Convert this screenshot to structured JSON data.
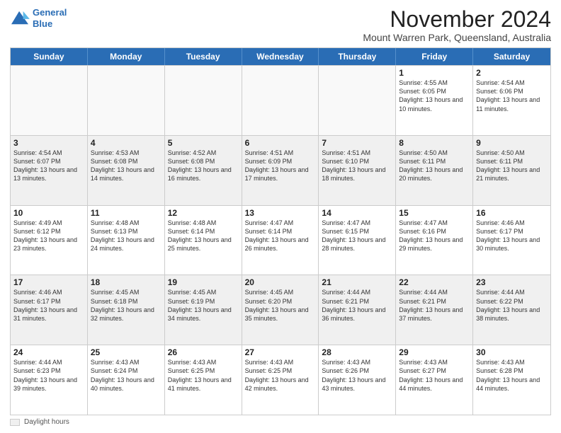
{
  "header": {
    "logo_line1": "General",
    "logo_line2": "Blue",
    "month_title": "November 2024",
    "location": "Mount Warren Park, Queensland, Australia"
  },
  "days_of_week": [
    "Sunday",
    "Monday",
    "Tuesday",
    "Wednesday",
    "Thursday",
    "Friday",
    "Saturday"
  ],
  "legend_label": "Daylight hours",
  "weeks": [
    [
      {
        "day": "",
        "text": "",
        "empty": true
      },
      {
        "day": "",
        "text": "",
        "empty": true
      },
      {
        "day": "",
        "text": "",
        "empty": true
      },
      {
        "day": "",
        "text": "",
        "empty": true
      },
      {
        "day": "",
        "text": "",
        "empty": true
      },
      {
        "day": "1",
        "text": "Sunrise: 4:55 AM\nSunset: 6:05 PM\nDaylight: 13 hours and 10 minutes.",
        "empty": false
      },
      {
        "day": "2",
        "text": "Sunrise: 4:54 AM\nSunset: 6:06 PM\nDaylight: 13 hours and 11 minutes.",
        "empty": false
      }
    ],
    [
      {
        "day": "3",
        "text": "Sunrise: 4:54 AM\nSunset: 6:07 PM\nDaylight: 13 hours and 13 minutes.",
        "empty": false
      },
      {
        "day": "4",
        "text": "Sunrise: 4:53 AM\nSunset: 6:08 PM\nDaylight: 13 hours and 14 minutes.",
        "empty": false
      },
      {
        "day": "5",
        "text": "Sunrise: 4:52 AM\nSunset: 6:08 PM\nDaylight: 13 hours and 16 minutes.",
        "empty": false
      },
      {
        "day": "6",
        "text": "Sunrise: 4:51 AM\nSunset: 6:09 PM\nDaylight: 13 hours and 17 minutes.",
        "empty": false
      },
      {
        "day": "7",
        "text": "Sunrise: 4:51 AM\nSunset: 6:10 PM\nDaylight: 13 hours and 18 minutes.",
        "empty": false
      },
      {
        "day": "8",
        "text": "Sunrise: 4:50 AM\nSunset: 6:11 PM\nDaylight: 13 hours and 20 minutes.",
        "empty": false
      },
      {
        "day": "9",
        "text": "Sunrise: 4:50 AM\nSunset: 6:11 PM\nDaylight: 13 hours and 21 minutes.",
        "empty": false
      }
    ],
    [
      {
        "day": "10",
        "text": "Sunrise: 4:49 AM\nSunset: 6:12 PM\nDaylight: 13 hours and 23 minutes.",
        "empty": false
      },
      {
        "day": "11",
        "text": "Sunrise: 4:48 AM\nSunset: 6:13 PM\nDaylight: 13 hours and 24 minutes.",
        "empty": false
      },
      {
        "day": "12",
        "text": "Sunrise: 4:48 AM\nSunset: 6:14 PM\nDaylight: 13 hours and 25 minutes.",
        "empty": false
      },
      {
        "day": "13",
        "text": "Sunrise: 4:47 AM\nSunset: 6:14 PM\nDaylight: 13 hours and 26 minutes.",
        "empty": false
      },
      {
        "day": "14",
        "text": "Sunrise: 4:47 AM\nSunset: 6:15 PM\nDaylight: 13 hours and 28 minutes.",
        "empty": false
      },
      {
        "day": "15",
        "text": "Sunrise: 4:47 AM\nSunset: 6:16 PM\nDaylight: 13 hours and 29 minutes.",
        "empty": false
      },
      {
        "day": "16",
        "text": "Sunrise: 4:46 AM\nSunset: 6:17 PM\nDaylight: 13 hours and 30 minutes.",
        "empty": false
      }
    ],
    [
      {
        "day": "17",
        "text": "Sunrise: 4:46 AM\nSunset: 6:17 PM\nDaylight: 13 hours and 31 minutes.",
        "empty": false
      },
      {
        "day": "18",
        "text": "Sunrise: 4:45 AM\nSunset: 6:18 PM\nDaylight: 13 hours and 32 minutes.",
        "empty": false
      },
      {
        "day": "19",
        "text": "Sunrise: 4:45 AM\nSunset: 6:19 PM\nDaylight: 13 hours and 34 minutes.",
        "empty": false
      },
      {
        "day": "20",
        "text": "Sunrise: 4:45 AM\nSunset: 6:20 PM\nDaylight: 13 hours and 35 minutes.",
        "empty": false
      },
      {
        "day": "21",
        "text": "Sunrise: 4:44 AM\nSunset: 6:21 PM\nDaylight: 13 hours and 36 minutes.",
        "empty": false
      },
      {
        "day": "22",
        "text": "Sunrise: 4:44 AM\nSunset: 6:21 PM\nDaylight: 13 hours and 37 minutes.",
        "empty": false
      },
      {
        "day": "23",
        "text": "Sunrise: 4:44 AM\nSunset: 6:22 PM\nDaylight: 13 hours and 38 minutes.",
        "empty": false
      }
    ],
    [
      {
        "day": "24",
        "text": "Sunrise: 4:44 AM\nSunset: 6:23 PM\nDaylight: 13 hours and 39 minutes.",
        "empty": false
      },
      {
        "day": "25",
        "text": "Sunrise: 4:43 AM\nSunset: 6:24 PM\nDaylight: 13 hours and 40 minutes.",
        "empty": false
      },
      {
        "day": "26",
        "text": "Sunrise: 4:43 AM\nSunset: 6:25 PM\nDaylight: 13 hours and 41 minutes.",
        "empty": false
      },
      {
        "day": "27",
        "text": "Sunrise: 4:43 AM\nSunset: 6:25 PM\nDaylight: 13 hours and 42 minutes.",
        "empty": false
      },
      {
        "day": "28",
        "text": "Sunrise: 4:43 AM\nSunset: 6:26 PM\nDaylight: 13 hours and 43 minutes.",
        "empty": false
      },
      {
        "day": "29",
        "text": "Sunrise: 4:43 AM\nSunset: 6:27 PM\nDaylight: 13 hours and 44 minutes.",
        "empty": false
      },
      {
        "day": "30",
        "text": "Sunrise: 4:43 AM\nSunset: 6:28 PM\nDaylight: 13 hours and 44 minutes.",
        "empty": false
      }
    ]
  ]
}
